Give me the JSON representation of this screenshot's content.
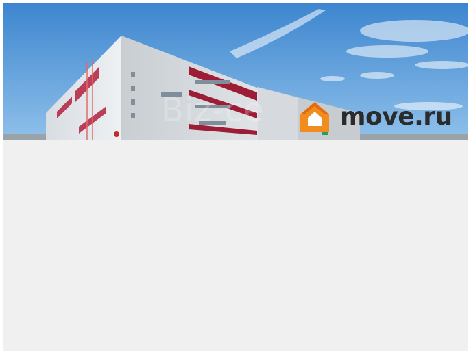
{
  "banner": {
    "logo_text": "move.ru",
    "watermark_text": "Biz-ce",
    "brand_color": "#f28c1e",
    "logo_text_color": "#2b2b2b",
    "sky_color": "#4f94d6",
    "icon": "house-logo-icon"
  },
  "content": {
    "background": "#f0f0f0"
  }
}
